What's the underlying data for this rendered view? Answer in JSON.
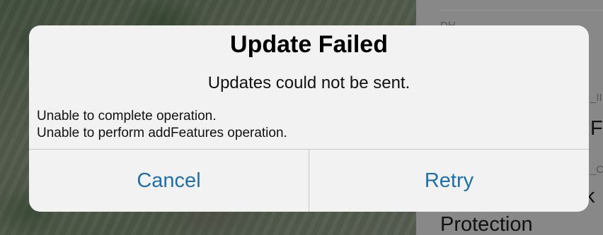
{
  "alert": {
    "title": "Update Failed",
    "message": "Updates could not be sent.",
    "details": [
      "Unable to complete operation.",
      "Unable to perform addFeatures operation."
    ],
    "buttons": {
      "cancel": "Cancel",
      "retry": "Retry"
    },
    "button_color": "#1f6faa"
  },
  "background_panel": {
    "label_top": "DH",
    "label_mid": "_II",
    "value_mid": "F",
    "label_low": "_C",
    "value_low": "k",
    "value_bottom": "Protection"
  }
}
